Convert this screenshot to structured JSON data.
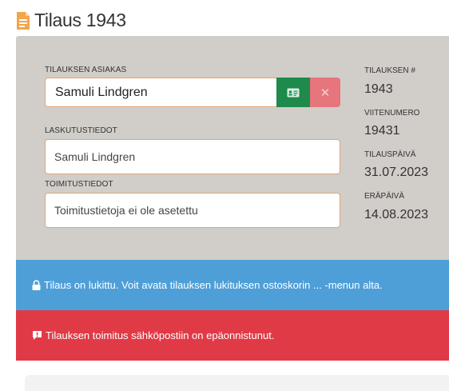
{
  "page": {
    "title": "Tilaus 1943"
  },
  "form": {
    "customer_label": "TILAUKSEN ASIAKAS",
    "customer_value": "Samuli Lindgren",
    "billing_label": "LASKUTUSTIEDOT",
    "billing_value": "Samuli Lindgren",
    "delivery_label": "TOIMITUSTIEDOT",
    "delivery_value": "Toimitustietoja ei ole asetettu",
    "clear_symbol": "✕"
  },
  "meta": {
    "order_no_label": "TILAUKSEN #",
    "order_no": "1943",
    "reference_label": "VIITENUMERO",
    "reference": "19431",
    "order_date_label": "TILAUSPÄIVÄ",
    "order_date": "31.07.2023",
    "due_date_label": "ERÄPÄIVÄ",
    "due_date": "14.08.2023"
  },
  "alerts": {
    "locked": "Tilaus on lukittu. Voit avata tilauksen lukituksen ostoskorin ... -menun alta.",
    "email_failed": "Tilauksen toimitus sähköpostiin on epäonnistunut."
  },
  "colors": {
    "panel": "#d1cdc8",
    "info": "#4e9fd8",
    "danger": "#e13a47",
    "success": "#1e8a4c",
    "input_border": "#e3a575"
  },
  "icons": {
    "title": "document-icon",
    "customer_button": "id-card-icon",
    "clear_button": "close-icon",
    "locked": "lock-icon",
    "error": "exclamation-comment-icon"
  }
}
